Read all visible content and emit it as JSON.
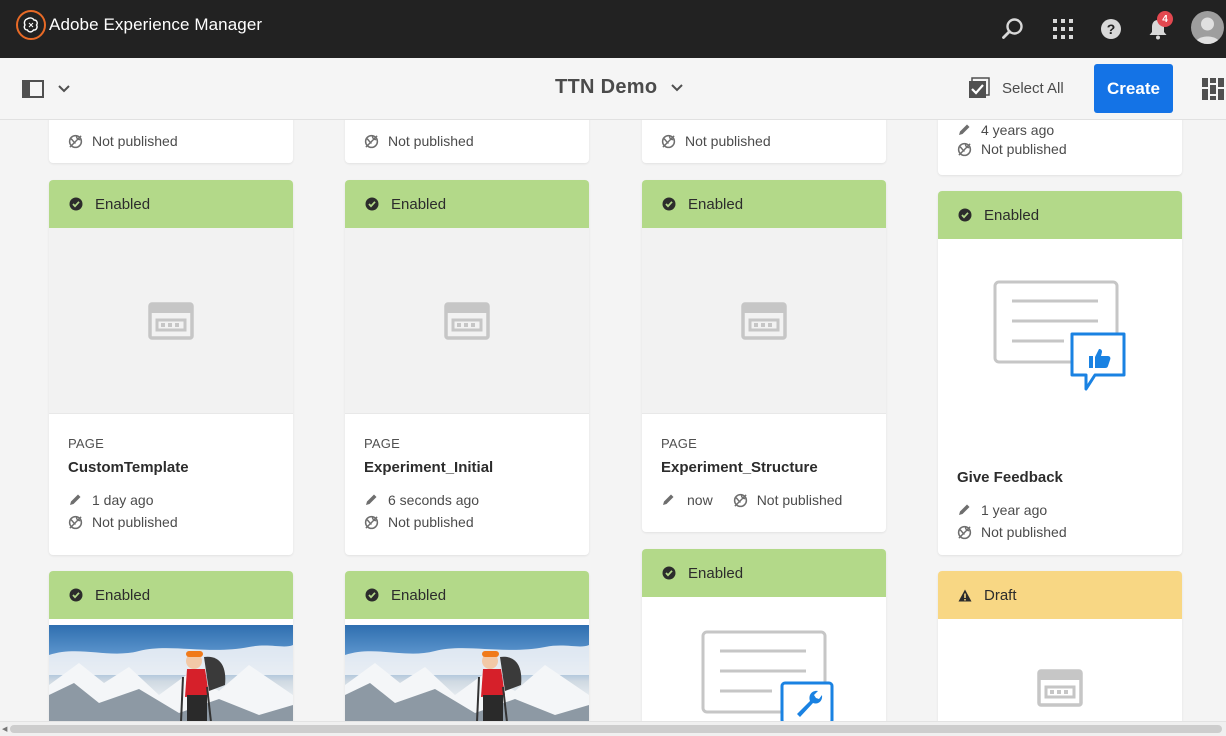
{
  "shell": {
    "title": "Adobe Experience Manager",
    "notification_count": "4",
    "icons": [
      "search-icon",
      "solutions-grid-icon",
      "help-icon",
      "bell-icon",
      "user-avatar"
    ]
  },
  "actionbar": {
    "title": "TTN Demo",
    "select_all": "Select All",
    "create": "Create"
  },
  "colors": {
    "shell_bg": "#222222",
    "accent": "#1473e6",
    "enabled": "#b3d989",
    "draft": "#f8d784"
  },
  "cards": {
    "top": [
      {
        "publish": "Not published"
      },
      {
        "publish": "Not published"
      },
      {
        "publish": "Not published"
      },
      {
        "modified": "4 years ago",
        "publish": "Not published"
      }
    ],
    "row1": [
      {
        "status": "Enabled",
        "kind": "PAGE",
        "name": "CustomTemplate",
        "modified": "1 day ago",
        "publish": "Not published"
      },
      {
        "status": "Enabled",
        "kind": "PAGE",
        "name": "Experiment_Initial",
        "modified": "6 seconds ago",
        "publish": "Not published"
      },
      {
        "status": "Enabled",
        "kind": "PAGE",
        "name": "Experiment_Structure",
        "modified": "now",
        "publish": "Not published"
      },
      {
        "status": "Enabled",
        "name": "Give Feedback",
        "modified": "1 year ago",
        "publish": "Not published"
      }
    ],
    "row2": [
      {
        "status": "Enabled"
      },
      {
        "status": "Enabled"
      },
      {
        "status": "Enabled"
      },
      {
        "status": "Draft"
      }
    ]
  }
}
